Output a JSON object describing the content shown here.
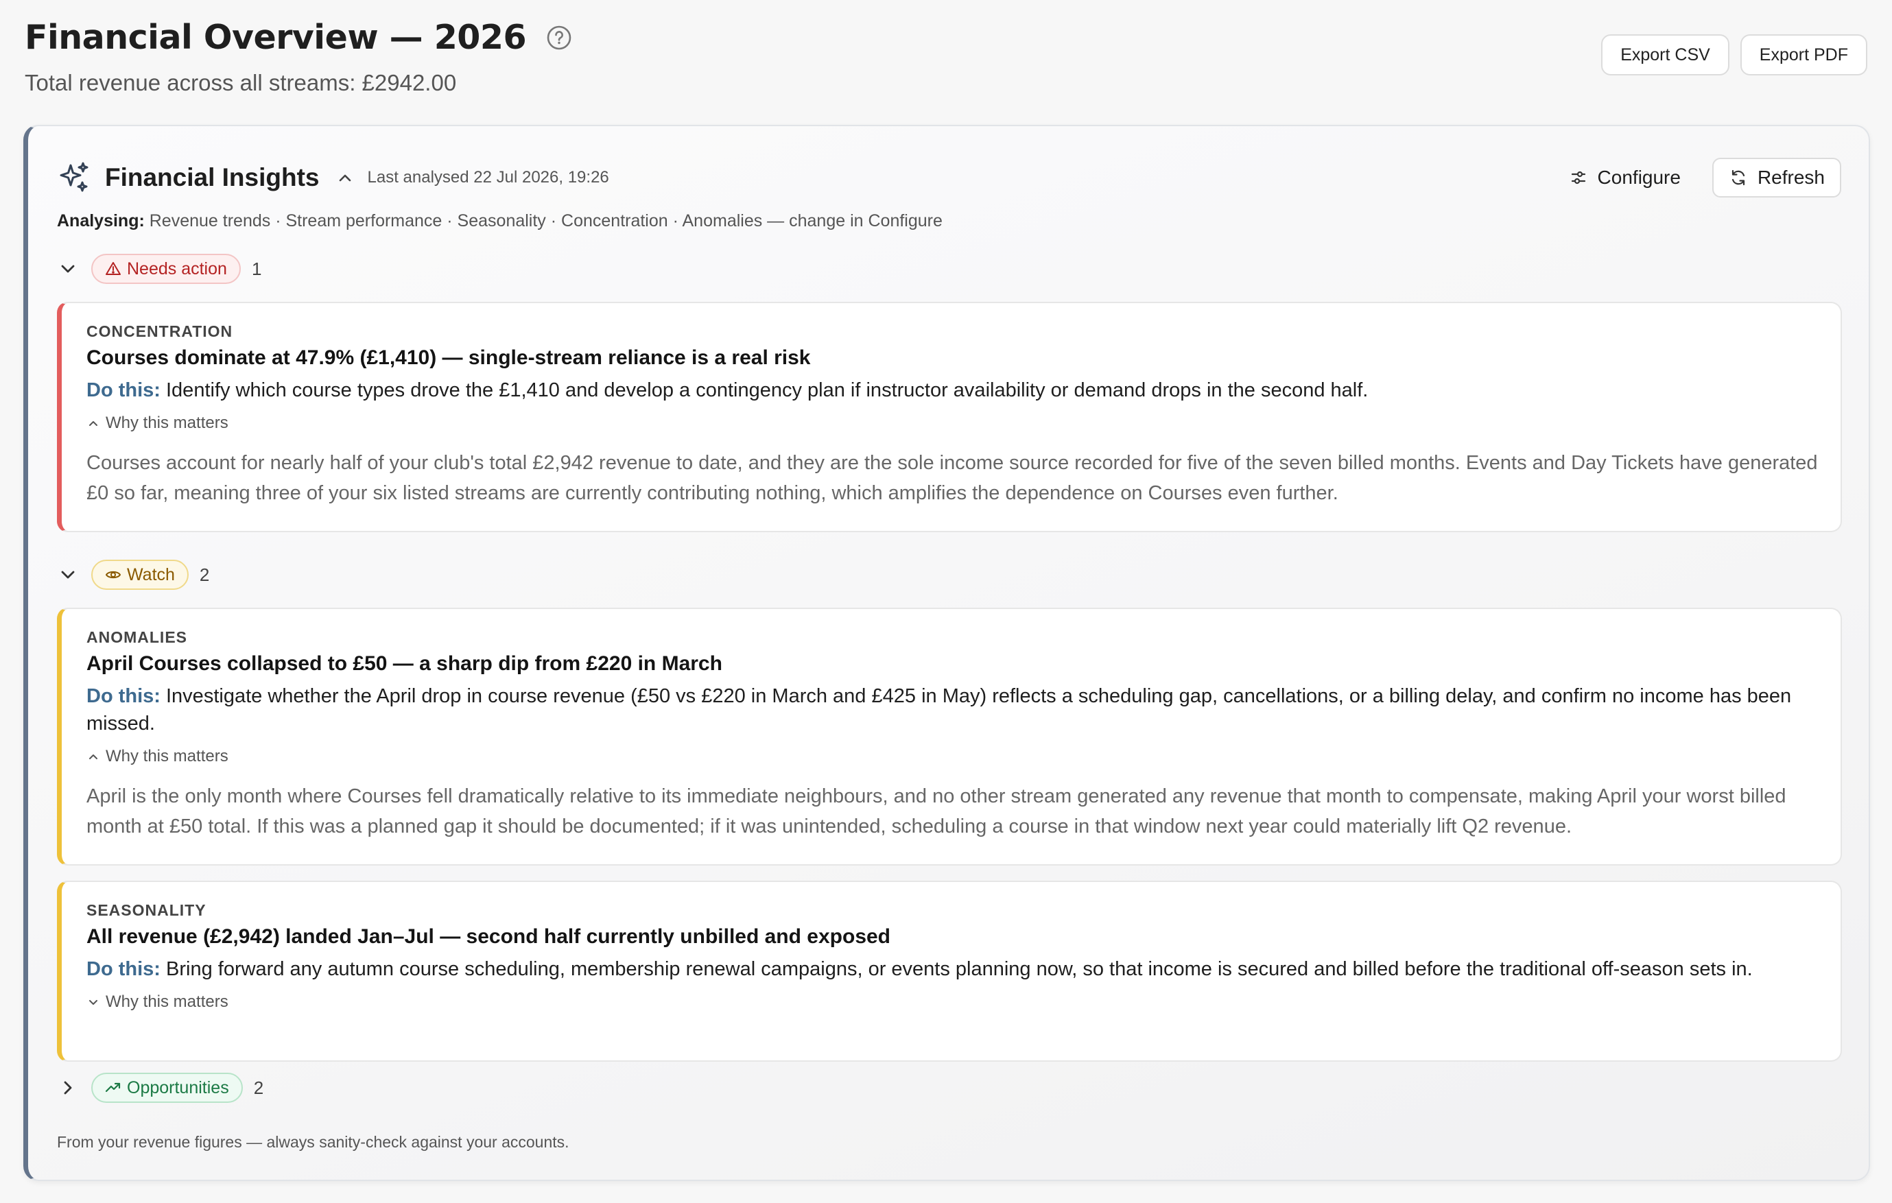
{
  "header": {
    "title": "Financial Overview — 2026",
    "subtitle": "Total revenue across all streams: £2942.00",
    "export_csv": "Export CSV",
    "export_pdf": "Export PDF"
  },
  "insights": {
    "title": "Financial Insights",
    "last_analysed": "Last analysed 22 Jul 2026, 19:26",
    "configure_label": "Configure",
    "refresh_label": "Refresh",
    "analysing_label": "Analysing:",
    "analysing_text": "Revenue trends · Stream performance · Seasonality · Concentration · Anomalies — change in Configure",
    "footer": "From your revenue figures — always sanity-check against your accounts."
  },
  "groups": [
    {
      "label": "Needs action",
      "count": "1",
      "color": "#e35d5d",
      "expanded": true,
      "cards": [
        {
          "category": "CONCENTRATION",
          "title": "Courses dominate at 47.9% (£1,410) — single-stream reliance is a real risk",
          "do_label": "Do this:",
          "do_text": "Identify which course types drove the £1,410 and develop a contingency plan if instructor availability or demand drops in the second half.",
          "why_label": "Why this matters",
          "why_expanded": true,
          "why_text": "Courses account for nearly half of your club's total £2,942 revenue to date, and they are the sole income source recorded for five of the seven billed months. Events and Day Tickets have generated £0 so far, meaning three of your six listed streams are currently contributing nothing, which amplifies the dependence on Courses even further."
        }
      ]
    },
    {
      "label": "Watch",
      "count": "2",
      "color": "#eec13a",
      "expanded": true,
      "cards": [
        {
          "category": "ANOMALIES",
          "title": "April Courses collapsed to £50 — a sharp dip from £220 in March",
          "do_label": "Do this:",
          "do_text": "Investigate whether the April drop in course revenue (£50 vs £220 in March and £425 in May) reflects a scheduling gap, cancellations, or a billing delay, and confirm no income has been missed.",
          "why_label": "Why this matters",
          "why_expanded": true,
          "why_text": "April is the only month where Courses fell dramatically relative to its immediate neighbours, and no other stream generated any revenue that month to compensate, making April your worst billed month at £50 total. If this was a planned gap it should be documented; if it was unintended, scheduling a course in that window next year could materially lift Q2 revenue."
        },
        {
          "category": "SEASONALITY",
          "title": "All revenue (£2,942) landed Jan–Jul — second half currently unbilled and exposed",
          "do_label": "Do this:",
          "do_text": "Bring forward any autumn course scheduling, membership renewal campaigns, or events planning now, so that income is secured and billed before the traditional off-season sets in.",
          "why_label": "Why this matters",
          "why_expanded": false
        }
      ]
    },
    {
      "label": "Opportunities",
      "count": "2",
      "color": "#1c7a45",
      "expanded": false
    }
  ]
}
